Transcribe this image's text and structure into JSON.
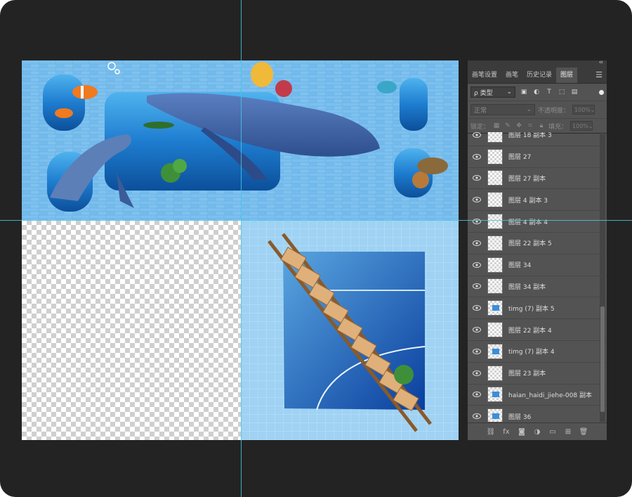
{
  "panel": {
    "collapse": "‹‹",
    "tabs": [
      {
        "label": "画笔设置"
      },
      {
        "label": "画笔"
      },
      {
        "label": "历史记录"
      },
      {
        "label": "图层"
      }
    ],
    "menu_icon": "hamburger-menu-icon",
    "filter": {
      "value": "ρ 类型"
    },
    "blend_mode": "正常",
    "opacity_label": "不透明度：",
    "opacity_value": "100%",
    "lock_label": "锁定：",
    "fill_label": "填充：",
    "fill_value": "100%",
    "layers": [
      {
        "name": "图层 18 副本 3"
      },
      {
        "name": "图层 27"
      },
      {
        "name": "图层 27 副本"
      },
      {
        "name": "图层 4 副本 3"
      },
      {
        "name": "图层 4 副本 4"
      },
      {
        "name": "图层 22 副本 5"
      },
      {
        "name": "图层 34"
      },
      {
        "name": "图层 34 副本"
      },
      {
        "name": "timg (7) 副本 5"
      },
      {
        "name": "图层 22 副本 4"
      },
      {
        "name": "timg (7) 副本 4"
      },
      {
        "name": "图层 23 副本"
      },
      {
        "name": "haian_haidi_jiehe-008 副本"
      },
      {
        "name": "图层 36"
      }
    ],
    "bottom_icons": [
      "link-icon",
      "fx-icon",
      "mask-icon",
      "adjustment-icon",
      "group-folder-icon",
      "new-layer-icon",
      "trash-icon"
    ]
  },
  "colors": {
    "background": "#232323",
    "panel": "#535353",
    "guide": "#49c6e0",
    "sea_blue": "#2f8ed8"
  }
}
